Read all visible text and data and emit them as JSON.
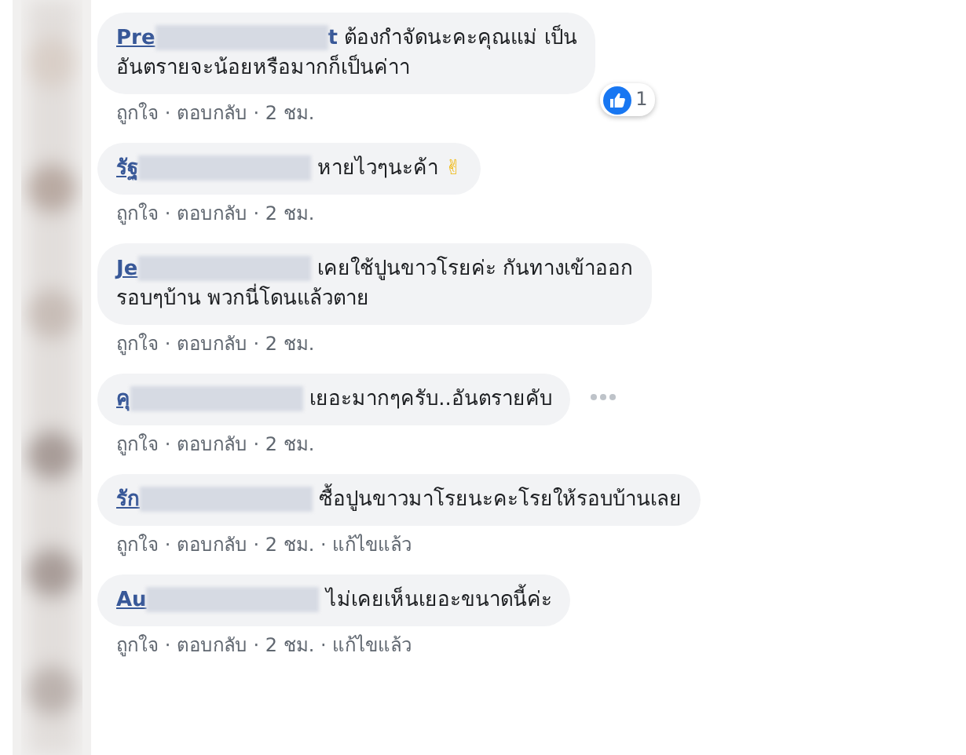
{
  "separator": "·",
  "comments": [
    {
      "name": "Pre",
      "name_tail": "t",
      "lines": [
        "ต้องกำจัดนะคะคุณแม่ เป็น",
        "อันตรายจะน้อยหรือมากก็เป็นค่าา"
      ],
      "reaction_count": "1",
      "more": false,
      "meta": [
        "ถูกใจ",
        "ตอบกลับ",
        "2 ชม."
      ]
    },
    {
      "name": "รัฐ",
      "lines": [
        "หายไวๆนะค้า"
      ],
      "emoji": "✌",
      "more": false,
      "meta": [
        "ถูกใจ",
        "ตอบกลับ",
        "2 ชม."
      ]
    },
    {
      "name": "Je",
      "lines": [
        "เคยใช้ปูนขาวโรยค่ะ กันทางเข้าออก",
        "รอบๆบ้าน พวกนี่โดนแล้วตาย"
      ],
      "more": false,
      "meta": [
        "ถูกใจ",
        "ตอบกลับ",
        "2 ชม."
      ]
    },
    {
      "name": "คุ",
      "lines": [
        "เยอะมากๆครับ..อันตรายคับ"
      ],
      "more": true,
      "meta": [
        "ถูกใจ",
        "ตอบกลับ",
        "2 ชม."
      ]
    },
    {
      "name": "รัก",
      "lines": [
        "ซื้อปูนขาวมาโรยนะคะโรยให้รอบบ้านเลย"
      ],
      "more": false,
      "meta": [
        "ถูกใจ",
        "ตอบกลับ",
        "2 ชม.",
        "แก้ไขแล้ว"
      ]
    },
    {
      "name": "Au",
      "lines": [
        "ไม่เคยเห็นเยอะขนาดนี้ค่ะ"
      ],
      "more": false,
      "meta": [
        "ถูกใจ",
        "ตอบกลับ",
        "2 ชม.",
        "แก้ไขแล้ว"
      ]
    }
  ]
}
